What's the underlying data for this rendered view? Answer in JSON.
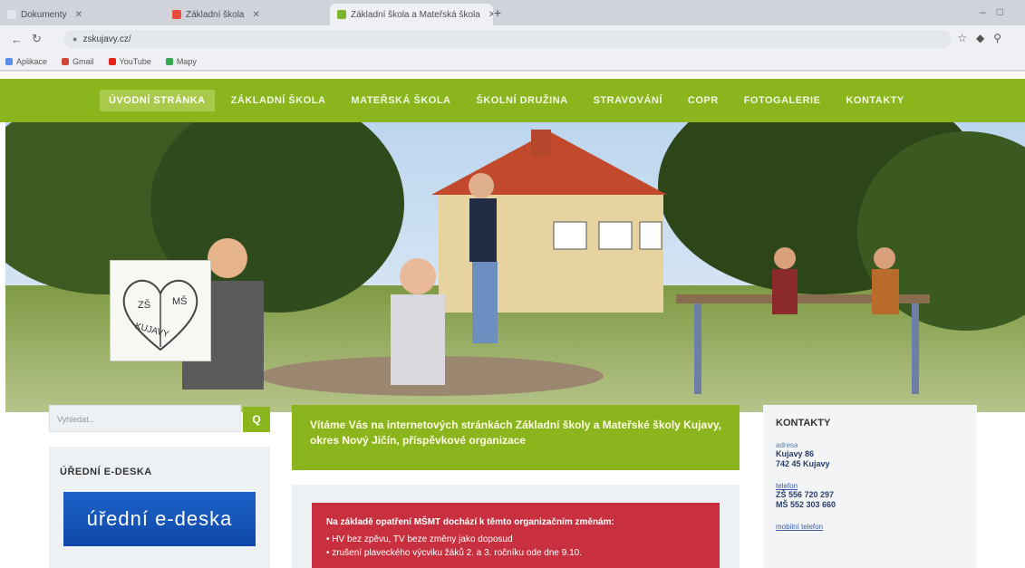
{
  "browser": {
    "tabs": [
      {
        "label": "Dokumenty",
        "fav": "#e4e8ed",
        "active": false
      },
      {
        "label": "Základní škola",
        "fav": "#e94d3b",
        "active": false
      },
      {
        "label": "Základní škola a Mateřská škola",
        "fav": "#7bb52b",
        "active": true
      }
    ],
    "new_tab": "+",
    "url": "zskujavy.cz/",
    "bookmarks": [
      {
        "label": "Aplikace",
        "color": "#5a8ee6"
      },
      {
        "label": "Gmail",
        "color": "#d44638"
      },
      {
        "label": "YouTube",
        "color": "#e62117"
      },
      {
        "label": "Mapy",
        "color": "#34a853"
      }
    ]
  },
  "menu": [
    {
      "label": "ÚVODNÍ STRÁNKA",
      "active": true
    },
    {
      "label": "ZÁKLADNÍ ŠKOLA",
      "active": false
    },
    {
      "label": "MATEŘSKÁ ŠKOLA",
      "active": false
    },
    {
      "label": "ŠKOLNÍ DRUŽINA",
      "active": false
    },
    {
      "label": "STRAVOVÁNÍ",
      "active": false
    },
    {
      "label": "COPR",
      "active": false
    },
    {
      "label": "FOTOGALERIE",
      "active": false
    },
    {
      "label": "KONTAKTY",
      "active": false
    }
  ],
  "logo": {
    "top_text": "ZŠ",
    "right_text": "MŠ",
    "bottom_text": "KUJAVY"
  },
  "search": {
    "placeholder": "Vyhledat...",
    "button": "Q"
  },
  "edeska": {
    "title": "ÚŘEDNÍ E-DESKA",
    "button": "úřední e-deska"
  },
  "welcome": "Vítáme Vás na internetových stránkách Základní školy a Mateřské školy Kujavy, okres Nový Jičín, příspěvkové organizace",
  "notice": {
    "head": "Na základě opatření MŠMT dochází k těmto organizačním změnám:",
    "lines": [
      "• HV bez zpěvu, TV beze změny jako doposud",
      "• zrušení plaveckého výcviku žáků 2. a 3. ročníku ode dne 9.10."
    ]
  },
  "contacts": {
    "title": "KONTAKTY",
    "address_label": "adresa",
    "address_line1": "Kujavy 86",
    "address_line2": "742 45 Kujavy",
    "phone_label": "telefon",
    "phone_zs": "ZŠ 556 720 297",
    "phone_ms": "MŠ 552 303 660",
    "mobile_label": "mobilní telefon"
  },
  "colors": {
    "brand_green": "#8ab51c",
    "notice_red": "#c9303f",
    "edeska_blue": "#1d63c9"
  }
}
